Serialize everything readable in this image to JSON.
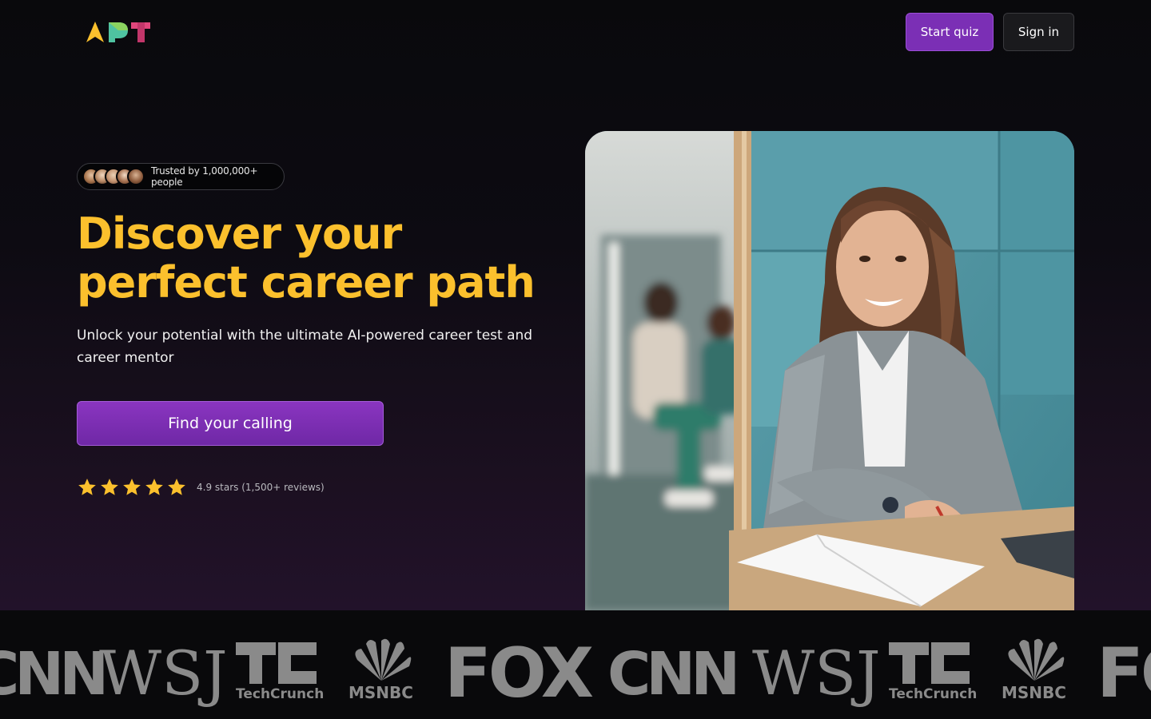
{
  "header": {
    "logo_letters": [
      "A",
      "P",
      "T"
    ],
    "logo_colors": [
      "#fbc02d",
      "#4fc3a1",
      "#e0467c"
    ],
    "start_quiz_label": "Start quiz",
    "sign_in_label": "Sign in"
  },
  "hero": {
    "trusted_text": "Trusted by 1,000,000+ people",
    "headline": "Discover your perfect career path",
    "subheadline": "Unlock your potential with the ultimate AI-powered career test and career mentor",
    "cta_label": "Find your calling",
    "rating_stars": 5,
    "rating_text": "4.9 stars (1,500+ reviews)"
  },
  "press": {
    "logos": [
      "CNN",
      "WSJ",
      "TechCrunch",
      "MSNBC",
      "FOX",
      "CNN",
      "WSJ",
      "TechCrunch",
      "MSNBC",
      "FOX"
    ]
  },
  "colors": {
    "accent_purple": "#7b2fb5",
    "headline_yellow": "#fbc02d",
    "background": "#08080b"
  }
}
